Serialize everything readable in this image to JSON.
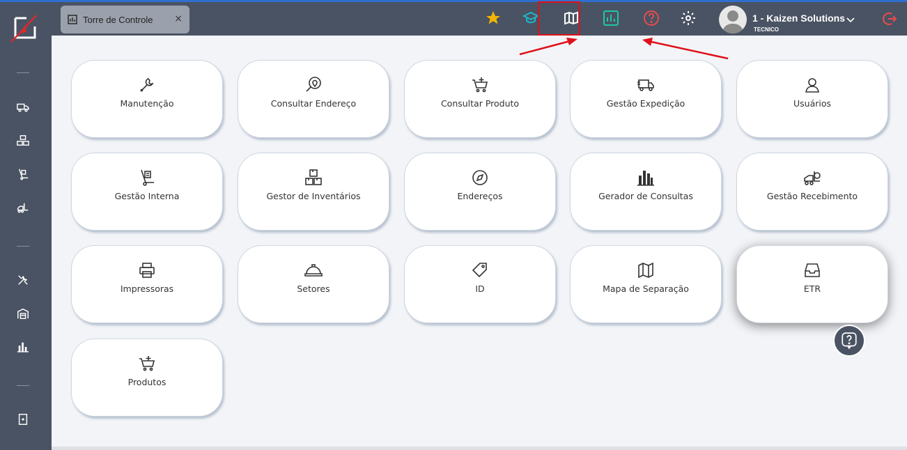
{
  "colors": {
    "accent_red": "#e0101a",
    "star": "#f5b400",
    "teal": "#1fb6c9",
    "active_green": "#1ec8a2",
    "help_red": "#e84c4c"
  },
  "tab": {
    "icon": "chart-icon",
    "label": "Torre de Controle",
    "close": "×"
  },
  "toolbar": {
    "icons": [
      "star-icon",
      "graduation-cap-icon",
      "map-icon",
      "chart-icon",
      "help-icon",
      "gear-icon"
    ]
  },
  "user": {
    "name": "1 - Kaizen Solutions",
    "role": "TECNICO"
  },
  "sidebar": {
    "icons": [
      "truck-icon",
      "boxes-icon",
      "hand-truck-icon",
      "forklift-icon",
      "tools-icon",
      "warehouse-icon",
      "chart-bars-icon",
      "document-icon"
    ]
  },
  "cards": [
    {
      "label": "Manutenção",
      "icon": "wrench-icon"
    },
    {
      "label": "Consultar Endereço",
      "icon": "location-search-icon"
    },
    {
      "label": "Consultar Produto",
      "icon": "cart-plus-icon"
    },
    {
      "label": "Gestão Expedição",
      "icon": "truck-icon"
    },
    {
      "label": "Usuários",
      "icon": "user-icon"
    },
    {
      "label": "Gestão Interna",
      "icon": "hand-truck-icon"
    },
    {
      "label": "Gestor de Inventários",
      "icon": "boxes-icon"
    },
    {
      "label": "Endereços",
      "icon": "compass-icon"
    },
    {
      "label": "Gerador de Consultas",
      "icon": "chart-bars-icon"
    },
    {
      "label": "Gestão Recebimento",
      "icon": "forklift-icon"
    },
    {
      "label": "Impressoras",
      "icon": "printer-icon"
    },
    {
      "label": "Setores",
      "icon": "hard-hat-icon"
    },
    {
      "label": "ID",
      "icon": "tag-icon"
    },
    {
      "label": "Mapa de Separação",
      "icon": "map-icon"
    },
    {
      "label": "ETR",
      "icon": "inbox-icon"
    },
    {
      "label": "Produtos",
      "icon": "cart-plus-icon"
    }
  ]
}
